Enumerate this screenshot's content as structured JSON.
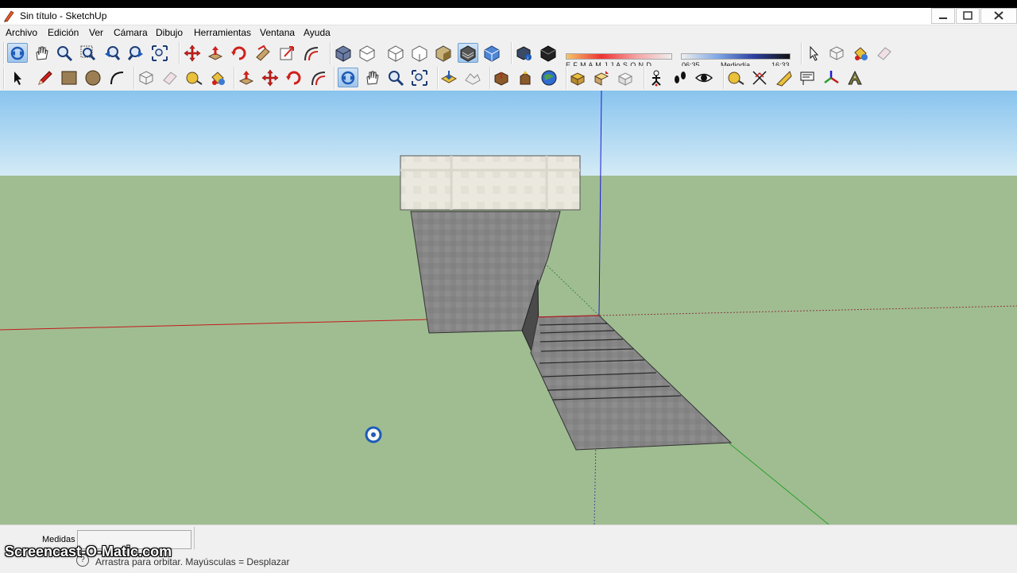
{
  "window": {
    "title": "Sin título - SketchUp"
  },
  "menu": [
    "Archivo",
    "Edición",
    "Ver",
    "Cámara",
    "Dibujo",
    "Herramientas",
    "Ventana",
    "Ayuda"
  ],
  "shadows": {
    "months": "E F M A M J J A S O N D",
    "time_start": "06:35",
    "time_mid": "Mediodía",
    "time_end": "16:33"
  },
  "status": {
    "measurements_label": "Medidas",
    "measurements_value": "",
    "hint": "Arrastra para orbitar. Mayúsculas = Desplazar"
  },
  "watermark": "Screencast-O-Matic.com",
  "colors": {
    "sky": "#a9d3f0",
    "ground": "#a0bd92",
    "red_axis": "#c21a1a",
    "green_axis": "#28a028",
    "blue_axis": "#1a1ad6",
    "selected_tool": "#9ec4ea"
  },
  "toolbar_row1": [
    "orbit-icon",
    "pan-icon",
    "zoom-icon",
    "zoom-window-icon",
    "zoom-extents-icon",
    "previous-view-icon",
    "next-view-icon",
    "move-icon",
    "push-pull-icon",
    "rotate-icon",
    "follow-me-icon",
    "scale-icon",
    "offset-icon",
    "iso-view-icon",
    "top-view-icon",
    "front-view-icon",
    "right-view-icon",
    "back-view-icon",
    "left-view-icon",
    "xray-icon",
    "wireframe-icon",
    "hidden-line-icon",
    "shaded-icon",
    "shaded-textures-icon",
    "monochrome-icon",
    "shadows-toggle-icon",
    "fog-icon",
    "select-icon",
    "make-component-icon",
    "paint-bucket-icon",
    "eraser-icon"
  ],
  "toolbar_row2": [
    "select-icon",
    "pencil-icon",
    "rectangle-icon",
    "circle-icon",
    "arc-icon",
    "make-component-icon",
    "eraser-icon",
    "tape-measure-icon",
    "paint-bucket-icon",
    "push-pull-icon",
    "move-icon",
    "rotate-icon",
    "follow-me-icon",
    "orbit-icon",
    "pan-icon",
    "zoom-icon",
    "zoom-extents-icon",
    "add-location-icon",
    "toggle-terrain-icon",
    "preview-google-earth-icon",
    "get-models-icon",
    "share-model-icon",
    "share-component-icon",
    "walk-icon",
    "position-camera-icon",
    "look-around-icon",
    "dimension-icon",
    "protractor-icon",
    "text-icon",
    "axes-icon",
    "3d-text-icon",
    "section-plane-icon"
  ]
}
